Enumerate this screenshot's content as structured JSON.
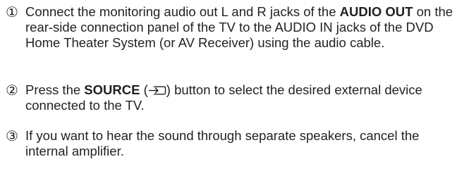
{
  "steps": [
    {
      "marker": "①",
      "text_a": "Connect the monitoring audio out L and R jacks of the ",
      "bold_a": "AUDIO OUT",
      "text_b": " on the rear-side connection panel of the TV to the AUDIO IN jacks of the DVD Home Theater System (or AV Receiver) using the audio cable."
    },
    {
      "marker": "②",
      "text_a": "Press the ",
      "bold_a": "SOURCE",
      "text_mid_open": " (",
      "icon": "source-input-icon",
      "text_mid_close": ")",
      "text_b": " button to select the desired external device connected to the TV."
    },
    {
      "marker": "③",
      "text_a": "If you want to hear the sound through separate speakers, cancel the internal amplifier."
    }
  ]
}
